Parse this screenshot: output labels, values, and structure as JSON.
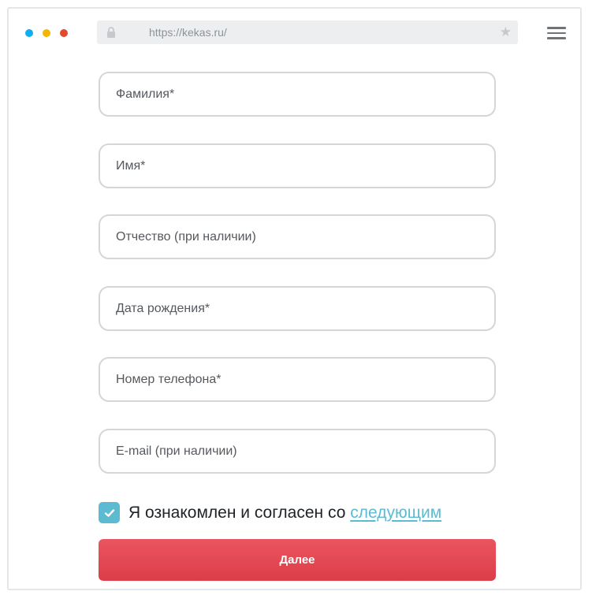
{
  "browser": {
    "url": "https://kekas.ru/",
    "dot_colors": [
      "#0eaef0",
      "#f2b705",
      "#e2492d"
    ]
  },
  "form": {
    "fields": [
      {
        "label": "Фамилия*"
      },
      {
        "label": "Имя*"
      },
      {
        "label": "Отчество (при наличии)"
      },
      {
        "label": "Дата рождения*"
      },
      {
        "label": "Номер телефона*"
      },
      {
        "label": "E-mail (при наличии)"
      }
    ],
    "agree": {
      "checked": true,
      "text": "Я ознакомлен и согласен со ",
      "link": "следующим"
    },
    "submit_label": "Далее"
  },
  "colors": {
    "accent": "#5cbbd0",
    "button": "#e0444f"
  }
}
